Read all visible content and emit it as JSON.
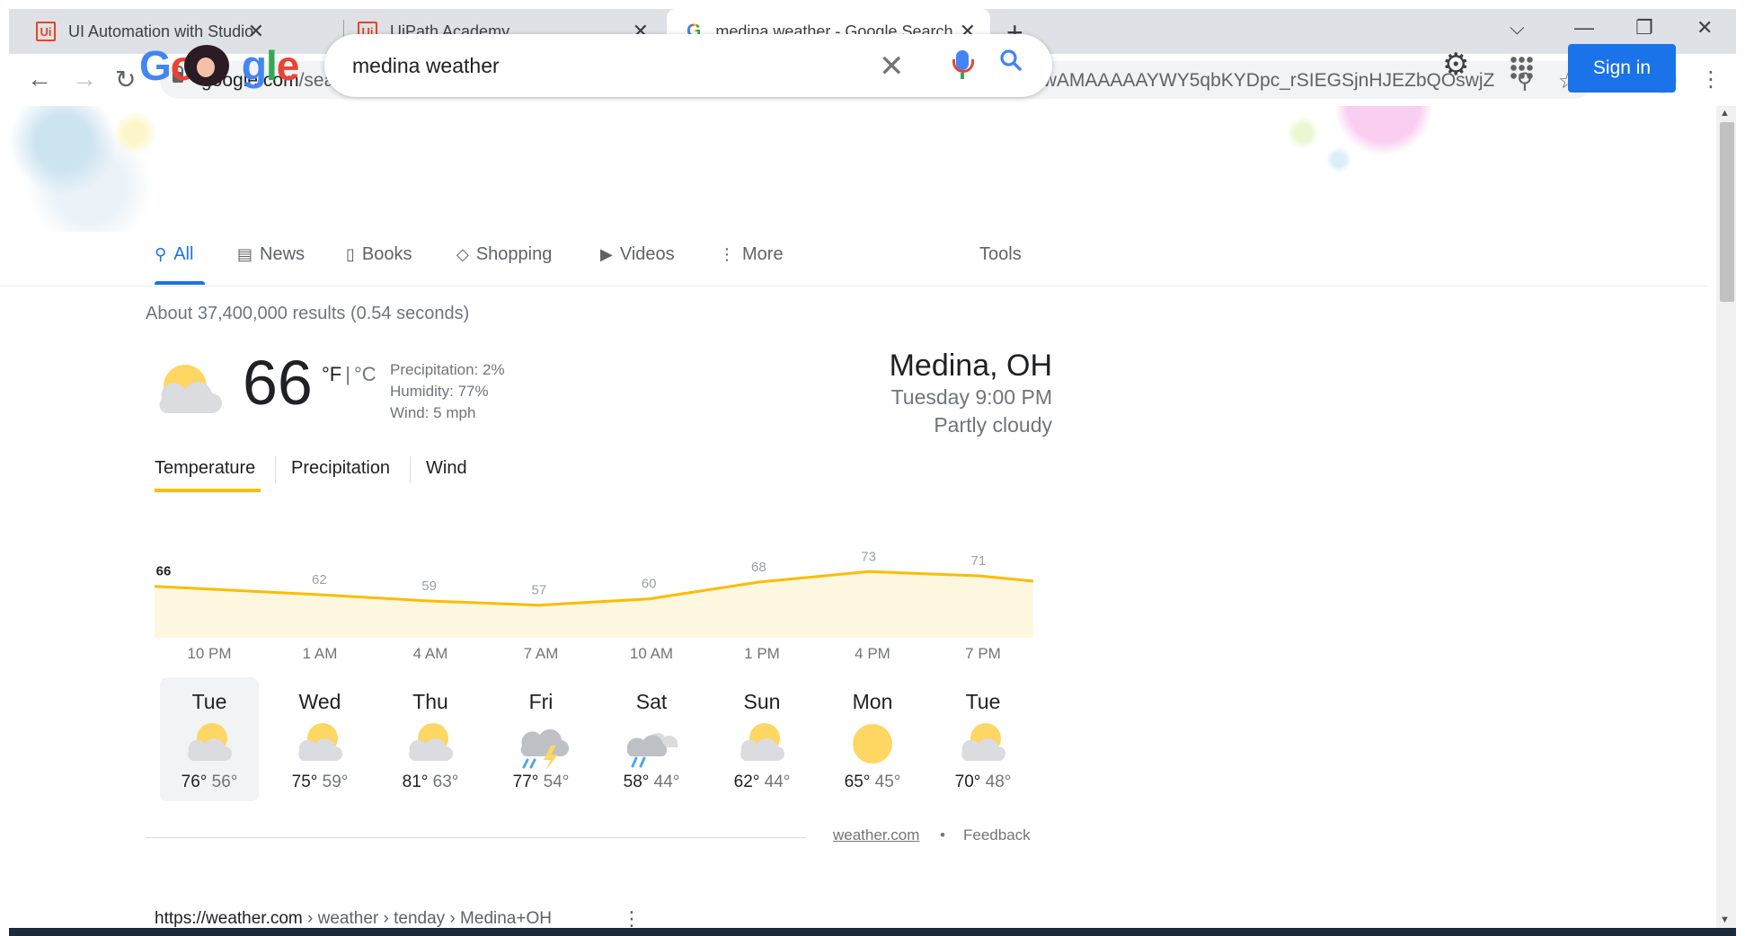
{
  "browser": {
    "tabs": [
      {
        "title": "UI Automation with Studio",
        "favicon": "uipath-icon"
      },
      {
        "title": "UiPath Academy",
        "favicon": "uipath-icon"
      },
      {
        "title": "medina weather - Google Search",
        "favicon": "google-g-icon"
      }
    ],
    "url_host": "google.com",
    "url_rest": "/search?q=medina+weather&source=hp&ei=mStmYYPSEamUxc8Pvq6kwA4&iflsig=ALs-wAMAAAAAYWY5qbKYDpc_rSIEGSjnHJEZbQOswjZ-&..."
  },
  "google": {
    "logo": "Google",
    "query": "medina weather",
    "sign_in": "Sign in",
    "tabs": [
      {
        "label": "All",
        "icon": "search-icon"
      },
      {
        "label": "News",
        "icon": "news-icon"
      },
      {
        "label": "Books",
        "icon": "book-icon"
      },
      {
        "label": "Shopping",
        "icon": "tag-icon"
      },
      {
        "label": "Videos",
        "icon": "play-icon"
      },
      {
        "label": "More",
        "icon": "more-vertical-icon"
      }
    ],
    "tools": "Tools",
    "results_count": "About 37,400,000 results (0.54 seconds)"
  },
  "weather": {
    "current_temp": "66",
    "unit_f": "°F",
    "unit_sep": "|",
    "unit_c": "°C",
    "precipitation": "Precipitation: 2%",
    "humidity": "Humidity: 77%",
    "wind": "Wind: 5 mph",
    "location": "Medina, OH",
    "datetime": "Tuesday 9:00 PM",
    "condition": "Partly cloudy",
    "tabs": [
      "Temperature",
      "Precipitation",
      "Wind"
    ],
    "hour_labels": [
      "10 PM",
      "1 AM",
      "4 AM",
      "7 AM",
      "10 AM",
      "1 PM",
      "4 PM",
      "7 PM"
    ],
    "daily": [
      {
        "day": "Tue",
        "high": "76°",
        "low": "56°",
        "icon": "partly-cloudy-icon"
      },
      {
        "day": "Wed",
        "high": "75°",
        "low": "59°",
        "icon": "partly-cloudy-icon"
      },
      {
        "day": "Thu",
        "high": "81°",
        "low": "63°",
        "icon": "partly-cloudy-icon"
      },
      {
        "day": "Fri",
        "high": "77°",
        "low": "54°",
        "icon": "thunderstorm-icon"
      },
      {
        "day": "Sat",
        "high": "58°",
        "low": "44°",
        "icon": "rain-icon"
      },
      {
        "day": "Sun",
        "high": "62°",
        "low": "44°",
        "icon": "partly-cloudy-icon"
      },
      {
        "day": "Mon",
        "high": "65°",
        "low": "45°",
        "icon": "sunny-icon"
      },
      {
        "day": "Tue",
        "high": "70°",
        "low": "48°",
        "icon": "partly-cloudy-icon"
      }
    ],
    "source": "weather.com",
    "dot": "•",
    "feedback": "Feedback"
  },
  "result": {
    "cite_host": "https://weather.com",
    "cite_path": " › weather › tenday › Medina+OH"
  },
  "chart_data": {
    "type": "area",
    "x": [
      "10 PM",
      "1 AM",
      "4 AM",
      "7 AM",
      "10 AM",
      "1 PM",
      "4 PM",
      "7 PM"
    ],
    "values": [
      66,
      62,
      59,
      57,
      60,
      68,
      73,
      71
    ],
    "ylim": [
      50,
      80
    ],
    "colors": {
      "line": "#fbbc04",
      "fill": "#fef7e0"
    }
  }
}
